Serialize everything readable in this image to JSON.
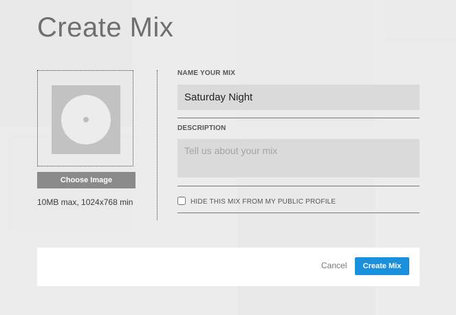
{
  "modal": {
    "title": "Create Mix"
  },
  "artwork": {
    "choose_label": "Choose Image",
    "hint": "10MB max, 1024x768 min"
  },
  "form": {
    "name_label": "NAME YOUR MIX",
    "name_value": "Saturday Night",
    "description_label": "DESCRIPTION",
    "description_placeholder": "Tell us about your mix",
    "description_value": "",
    "hide_label": "HIDE THIS MIX FROM MY PUBLIC PROFILE",
    "hide_checked": false
  },
  "footer": {
    "cancel_label": "Cancel",
    "submit_label": "Create Mix"
  },
  "colors": {
    "primary_button": "#1a8fdc",
    "secondary_button": "#8a8a8a",
    "input_background": "#dadada",
    "overlay": "#ececec"
  }
}
